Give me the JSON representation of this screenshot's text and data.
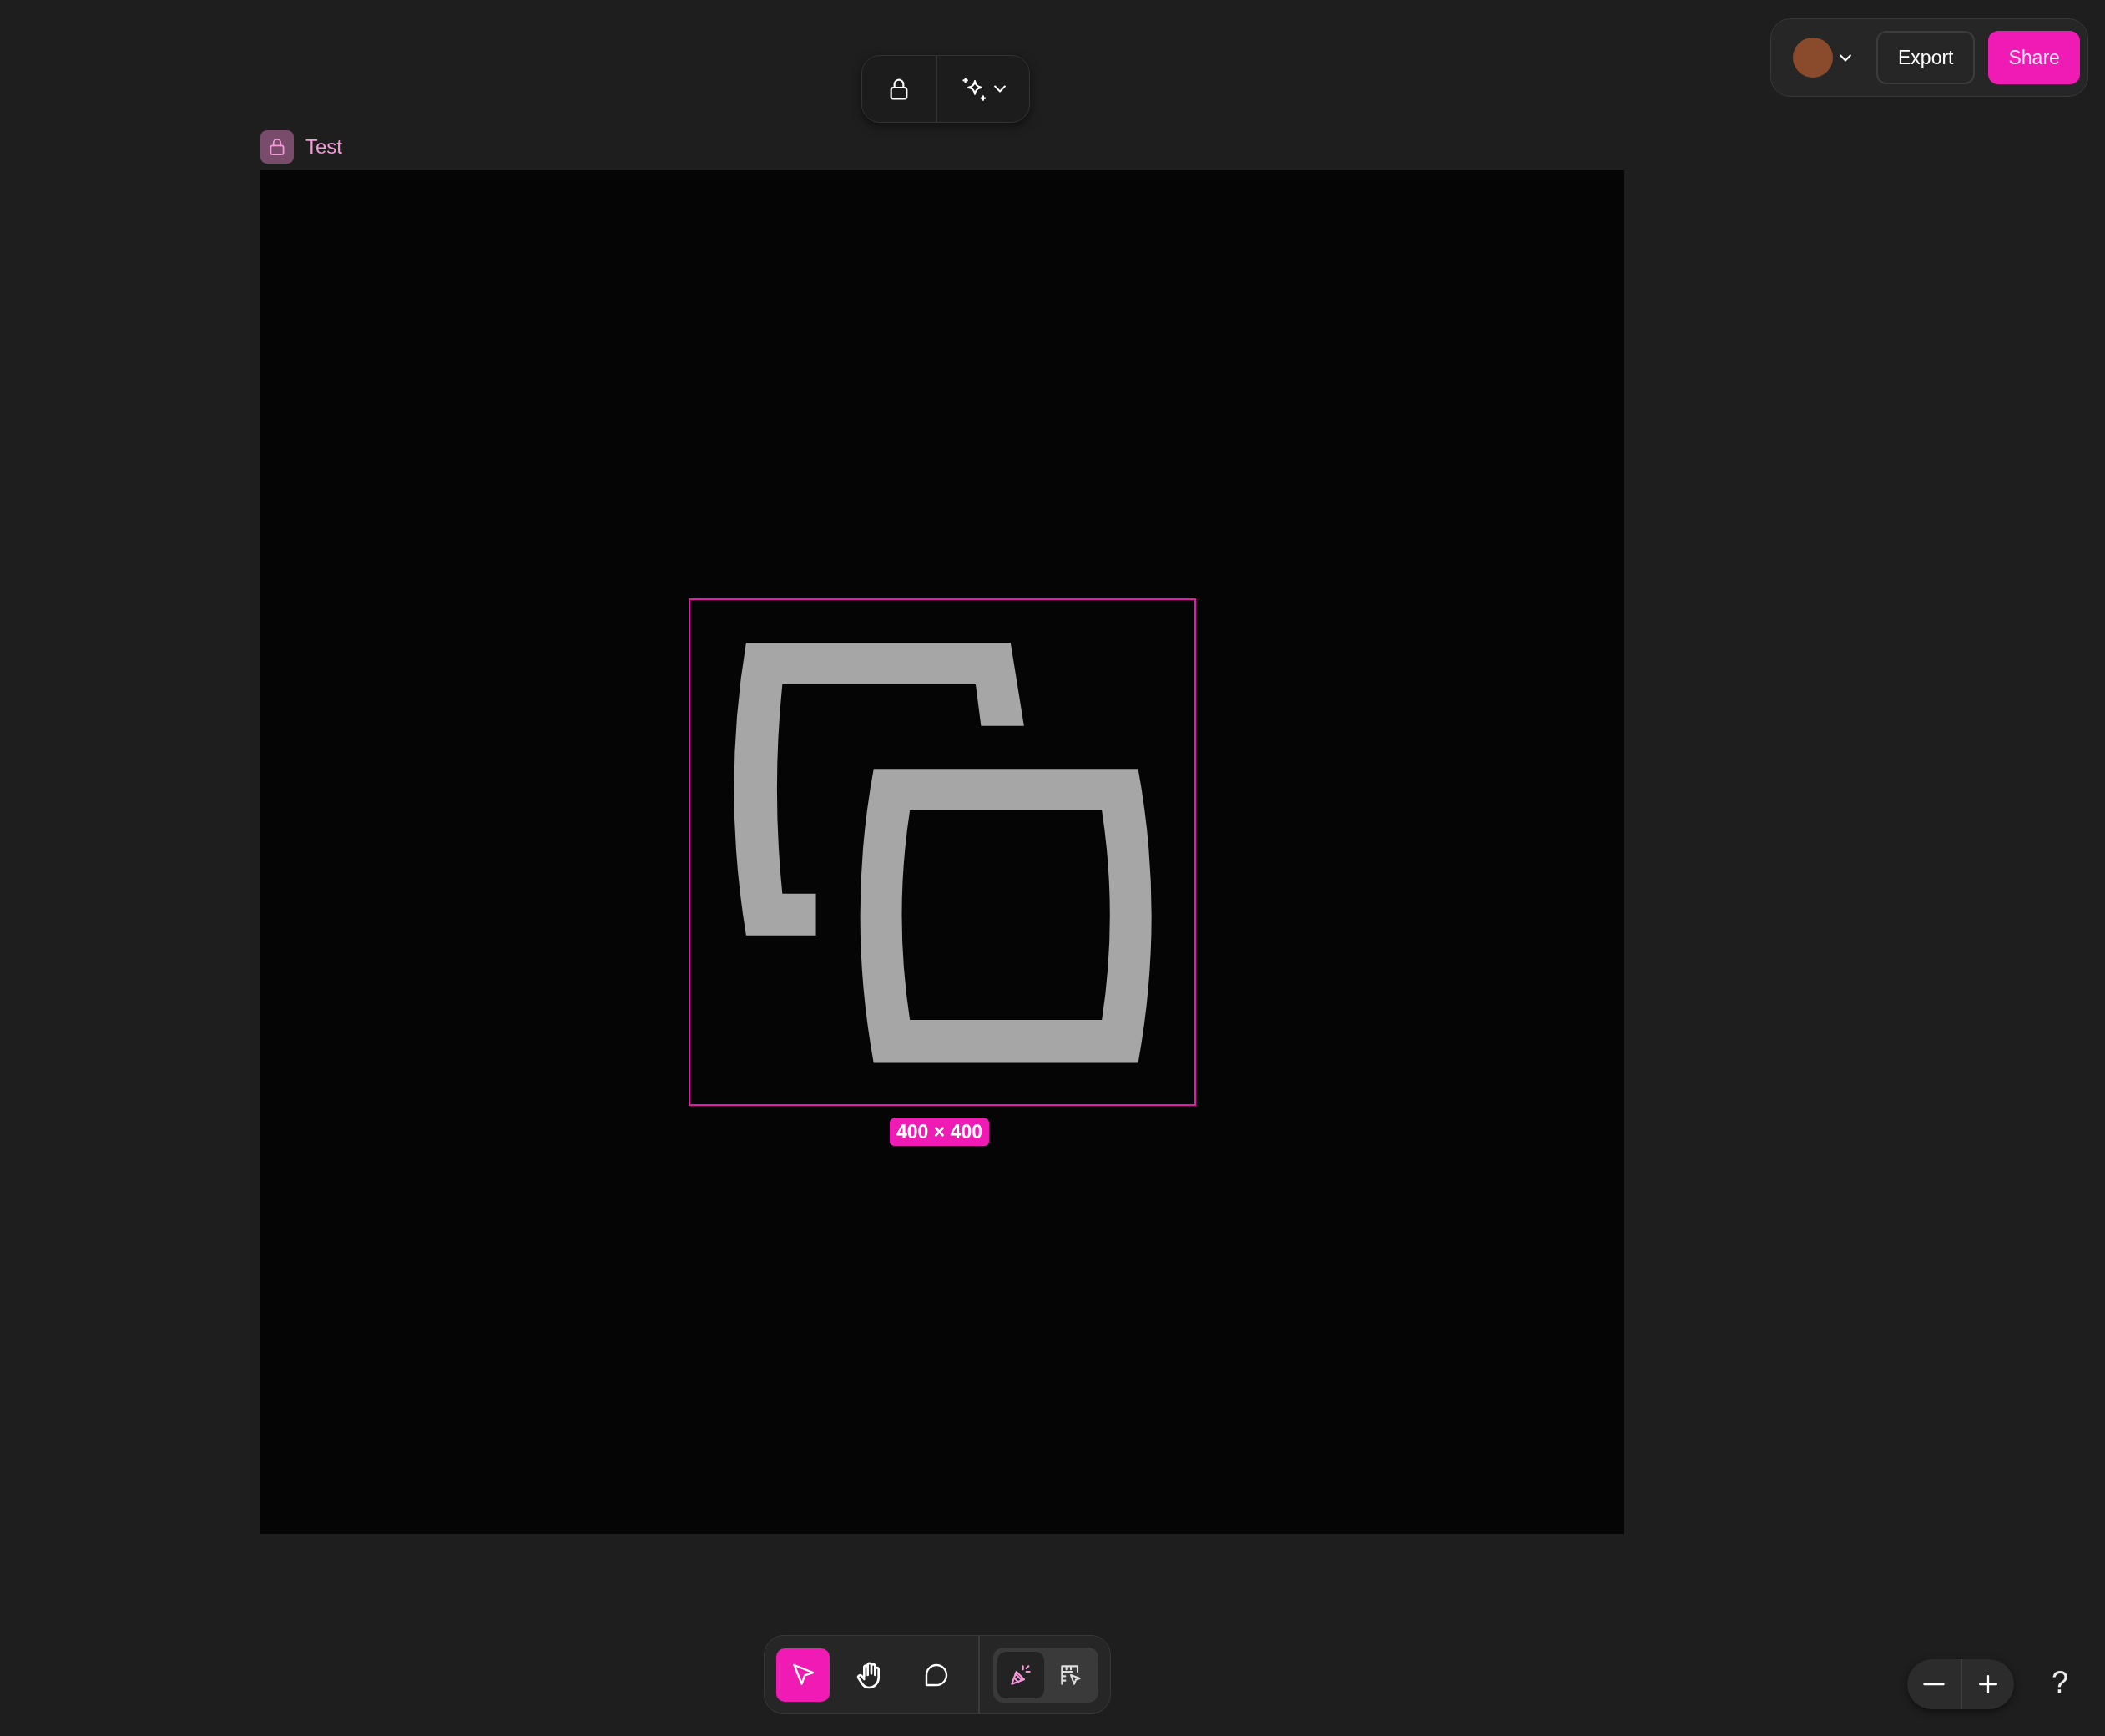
{
  "top_toolbar": [
    {
      "kind": "lock"
    },
    {
      "kind": "sparkle-menu"
    }
  ],
  "header": {
    "buttons": [
      {
        "label": "Export",
        "kind": "secondary"
      },
      {
        "label": "Share",
        "kind": "primary"
      }
    ]
  },
  "frame": {
    "name": "Test",
    "locked": true,
    "selection_size": "400 × 400"
  },
  "tools": [
    {
      "kind": "select",
      "selected": true
    },
    {
      "kind": "hand",
      "selected": false
    },
    {
      "kind": "comment",
      "selected": false
    }
  ],
  "modes": [
    {
      "kind": "design",
      "selected": true
    },
    {
      "kind": "dev",
      "selected": false
    }
  ],
  "help": "?"
}
